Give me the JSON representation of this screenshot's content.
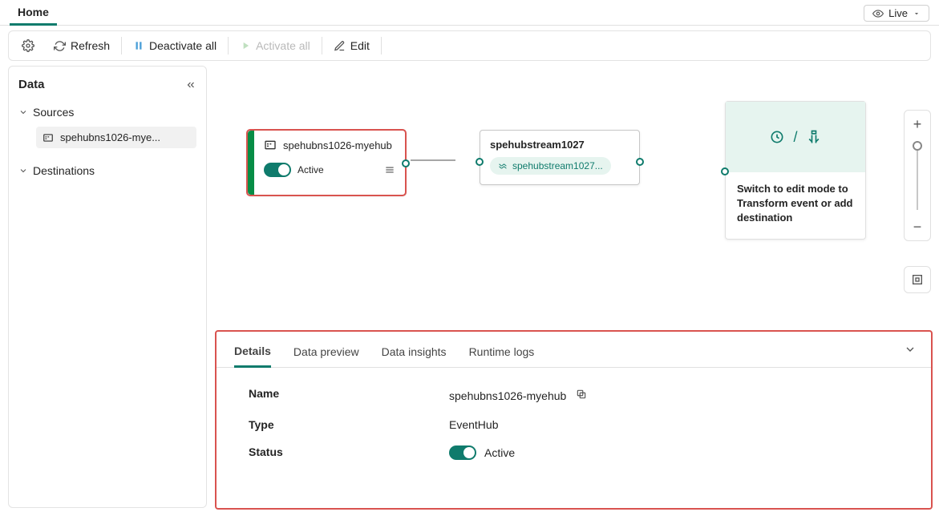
{
  "tab": {
    "home": "Home"
  },
  "live": {
    "label": "Live"
  },
  "toolbar": {
    "refresh": "Refresh",
    "deactivate_all": "Deactivate all",
    "activate_all": "Activate all",
    "edit": "Edit"
  },
  "sidebar": {
    "title": "Data",
    "groups": {
      "sources": "Sources",
      "destinations": "Destinations"
    },
    "items": {
      "source0": "spehubns1026-mye..."
    }
  },
  "canvas": {
    "node1": {
      "title": "spehubns1026-myehub",
      "status": "Active"
    },
    "node2": {
      "title": "spehubstream1027",
      "pill": "spehubstream1027..."
    },
    "node3": {
      "text": "Switch to edit mode to Transform event or add destination"
    }
  },
  "details": {
    "tabs": {
      "details": "Details",
      "preview": "Data preview",
      "insights": "Data insights",
      "logs": "Runtime logs"
    },
    "fields": {
      "name_label": "Name",
      "name_value": "spehubns1026-myehub",
      "type_label": "Type",
      "type_value": "EventHub",
      "status_label": "Status",
      "status_value": "Active"
    }
  }
}
